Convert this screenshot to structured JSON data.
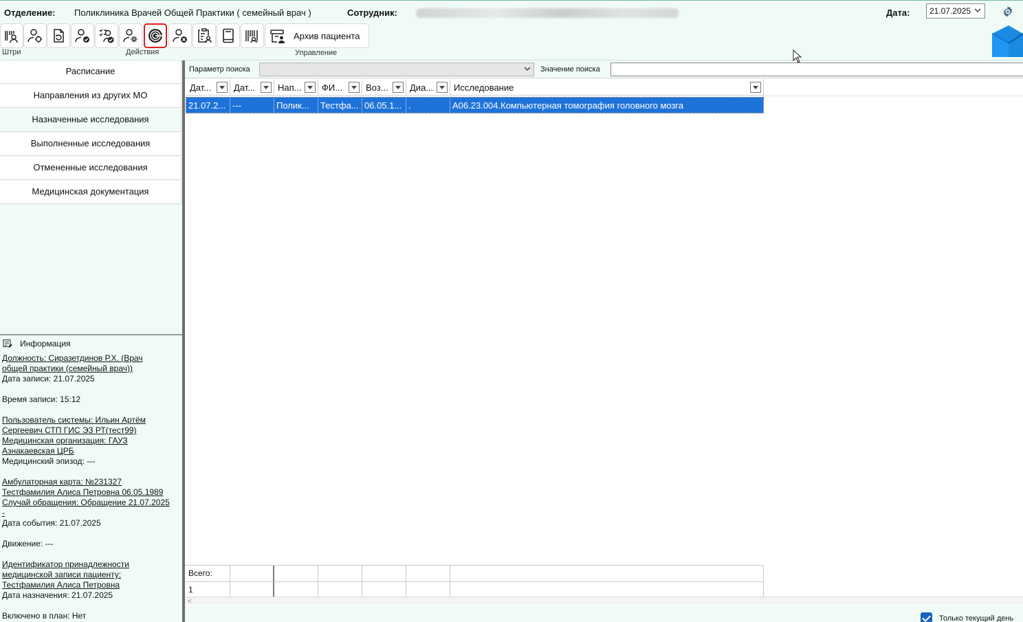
{
  "header": {
    "department_label": "Отделение:",
    "department_value": "Поликлиника Врачей Общей Практики ( семейный врач )",
    "employee_label": "Сотрудник:",
    "date_label": "Дата:",
    "date_value": "21.07.2025"
  },
  "toolbar": {
    "groups": [
      {
        "label": "Штри"
      },
      {
        "label": "Действия"
      },
      {
        "label": "Управление"
      }
    ],
    "archive_label": "Архив пациента",
    "icons": [
      "barcode-user-icon",
      "user-gear-icon",
      "document-refresh-icon",
      "user-check-icon",
      "user-list-check-icon",
      "user-settings-icon",
      "target-icon",
      "user-cancel-icon",
      "clipboard-user-icon",
      "book-icon",
      "barcode-icon"
    ]
  },
  "nav": {
    "items": [
      {
        "label": "Расписание"
      },
      {
        "label": "Направления из других МО"
      },
      {
        "label": "Назначенные исследования"
      },
      {
        "label": "Выполненные исследования"
      },
      {
        "label": "Отмененные исследования"
      },
      {
        "label": "Медицинская документация"
      }
    ],
    "selected": "Назначенные исследования"
  },
  "info": {
    "title": "Информация",
    "lines": [
      "Должность: Сиразетдинов Р.Х. (Врач ",
      "общей практики (семейный врач))",
      "Дата записи: 21.07.2025",
      "",
      "Время записи: 15:12",
      "",
      "Пользователь системы: Ильин Артём ",
      "Сергеевич СТП ГИС ЭЗ РТ(тест99)",
      "Медицинская организация: ГАУЗ ",
      "Азнакаевская ЦРБ",
      "Медицинский эпизод: ---",
      "",
      "Амбулаторная карта: №231327 ",
      "Тестфамилия Алиса Петровна 06.05.1989",
      "Случай обращения: Обращение 21.07.2025 ",
      "- ",
      "Дата события: 21.07.2025",
      "",
      "Движение: ---",
      "",
      "Идентификатор принадлежности ",
      "медицинской записи пациенту: ",
      "Тестфамилия Алиса Петровна",
      "Дата назначения: 21.07.2025",
      "",
      "Включено в план: Нет"
    ]
  },
  "search": {
    "param_label": "Параметр поиска",
    "param_value": "",
    "value_label": "Значение поиска",
    "value": ""
  },
  "grid": {
    "columns": [
      "Дат...",
      "Дат...",
      "Нап...",
      "ФИ...",
      "Воз...",
      "Диа...",
      "Исследование"
    ],
    "rows": [
      [
        "21.07.2...",
        "---",
        "Полик...",
        "Тестфа...",
        "06.05.1...",
        ".",
        "A06.23.004.Компьютерная томография головного мозга"
      ]
    ],
    "total_label": "Всего:",
    "total_count": "1"
  },
  "footer": {
    "today_only_label": "Только текущий день",
    "today_only_checked": true
  }
}
